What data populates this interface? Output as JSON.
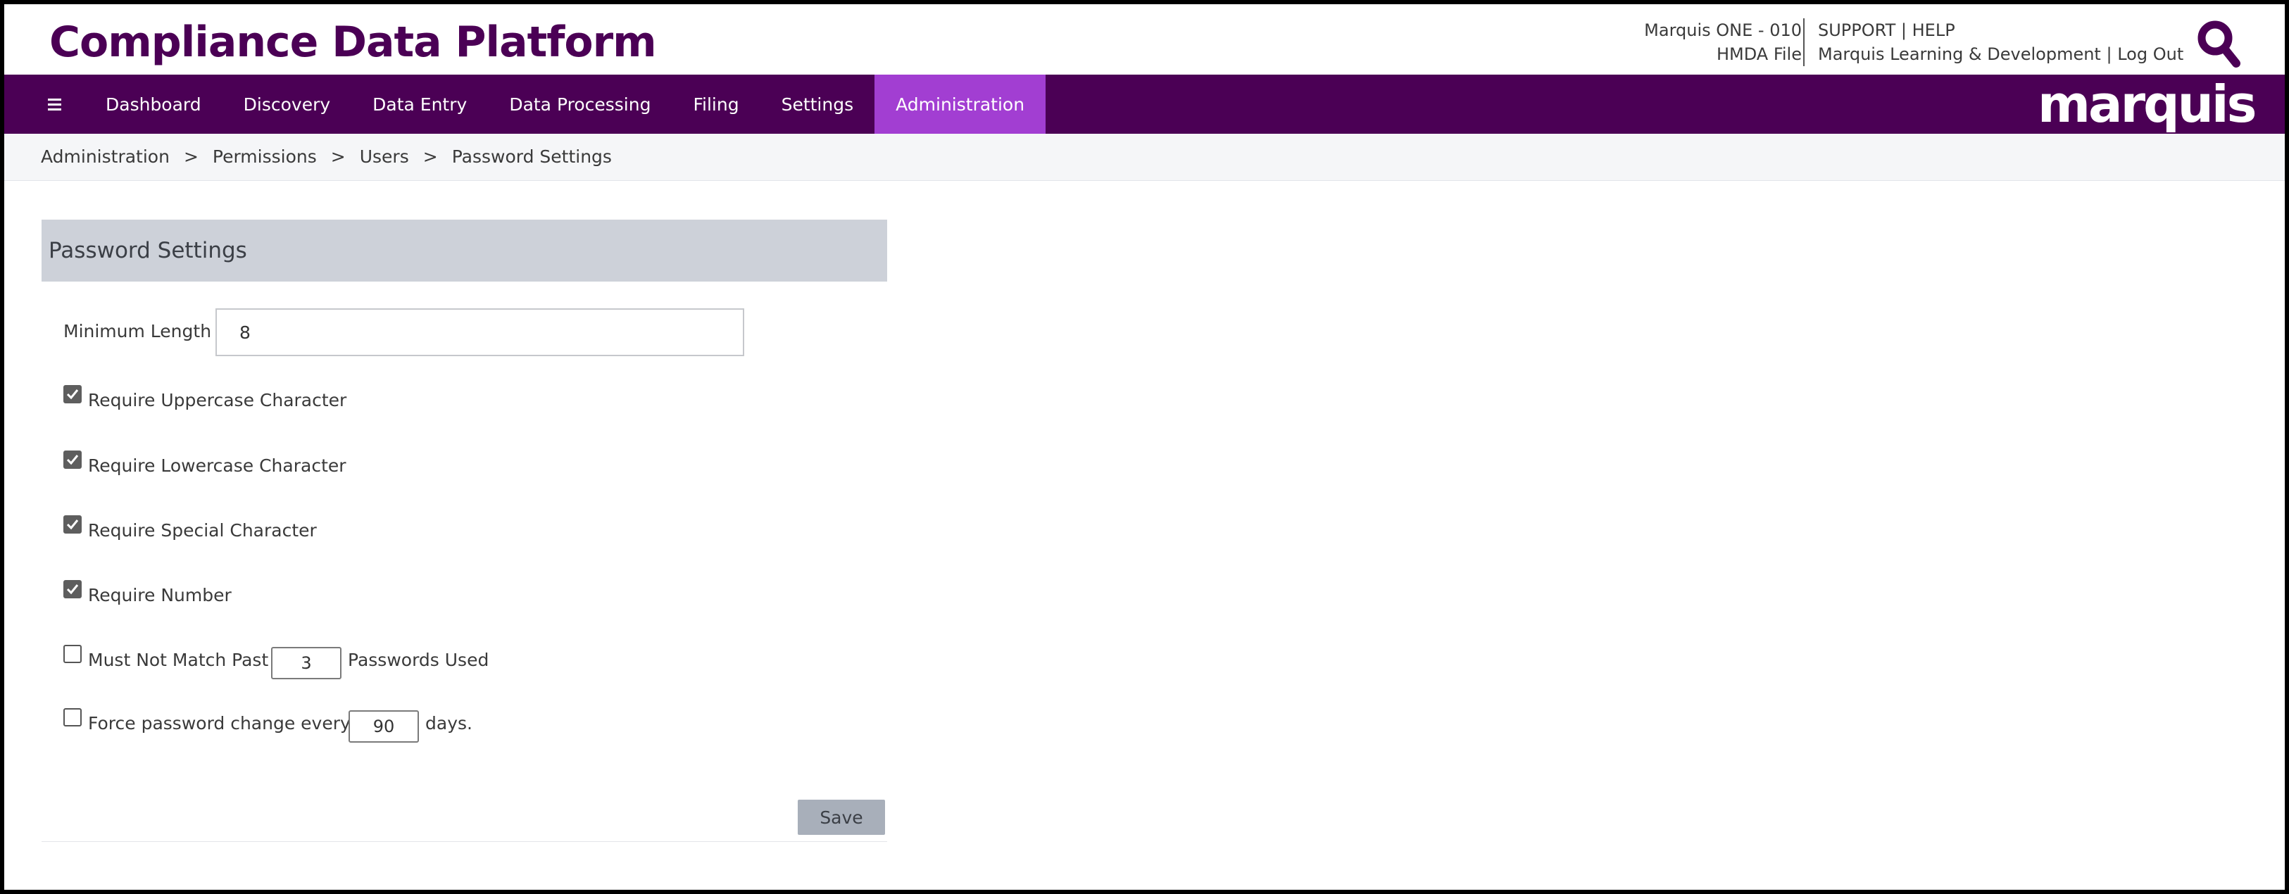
{
  "header": {
    "app_title": "Compliance Data Platform",
    "account_name": "Marquis ONE - 010",
    "account_file": "HMDA File",
    "links_row1": [
      "SUPPORT",
      "HELP"
    ],
    "links_row2": [
      "Marquis Learning & Development",
      "Log Out"
    ],
    "link_separator": "|",
    "search_icon": "search-icon"
  },
  "nav": {
    "menu_icon": "hamburger-icon",
    "items": [
      "Dashboard",
      "Discovery",
      "Data Entry",
      "Data Processing",
      "Filing",
      "Settings",
      "Administration"
    ],
    "active_item": "Administration",
    "brand_logo": "marquis"
  },
  "breadcrumb": {
    "items": [
      "Administration",
      "Permissions",
      "Users",
      "Password Settings"
    ],
    "separator": ">"
  },
  "panel": {
    "title": "Password Settings",
    "min_length_label": "Minimum Length",
    "min_length_value": "8",
    "options": [
      {
        "label": "Require Uppercase Character",
        "checked": true
      },
      {
        "label": "Require Lowercase Character",
        "checked": true
      },
      {
        "label": "Require Special Character",
        "checked": true
      },
      {
        "label": "Require Number",
        "checked": true
      }
    ],
    "history": {
      "checked": false,
      "label_before": "Must Not Match Past",
      "value": "3",
      "label_after": "Passwords Used"
    },
    "force_change": {
      "checked": false,
      "label_before": "Force password change every",
      "value": "90",
      "label_after": "days."
    },
    "save_label": "Save"
  },
  "colors": {
    "brand_purple": "#4b0055",
    "active_tab": "#a23ed2",
    "panel_header": "#cdd1d9",
    "save_button": "#a8afba"
  }
}
